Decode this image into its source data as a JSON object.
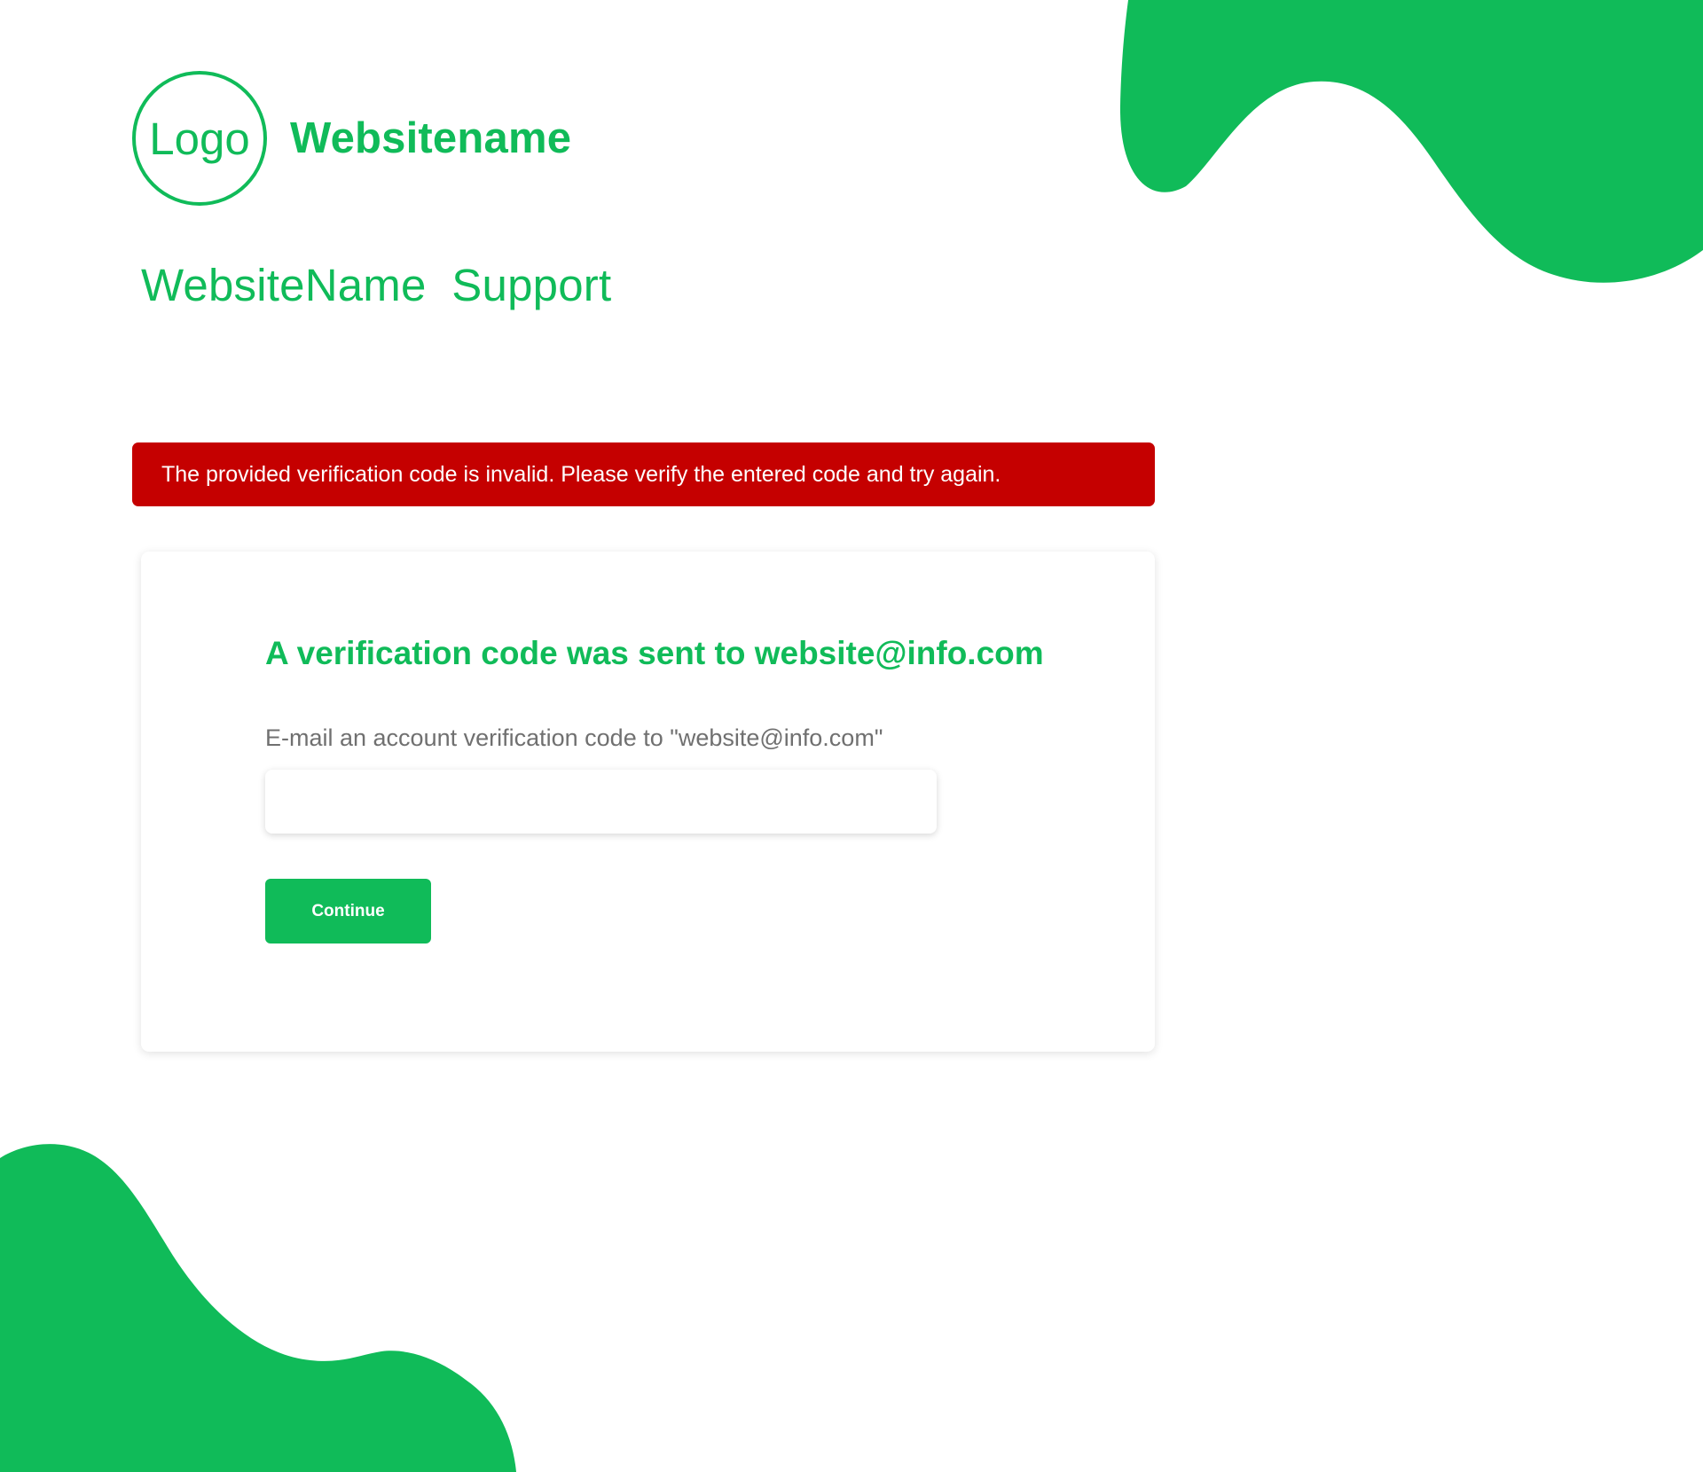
{
  "brand": {
    "logo_text": "Logo",
    "site_name": "Websitename"
  },
  "support_title": "WebsiteName  Support",
  "error": {
    "message": "The provided verification code is invalid. Please verify the entered code and try again."
  },
  "verification": {
    "heading": "A verification code was sent to website@info.com",
    "label": "E-mail an account verification code to \"website@info.com\"",
    "code_value": "",
    "continue_label": "Continue"
  },
  "colors": {
    "brand_green": "#10bb59",
    "error_red": "#c50000",
    "label_gray": "#707070",
    "background": "#ffffff"
  }
}
